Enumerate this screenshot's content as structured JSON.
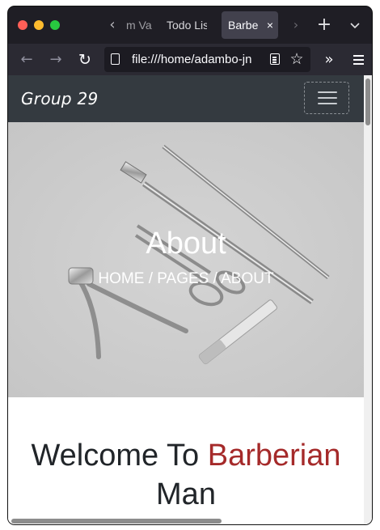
{
  "browser": {
    "tabs": [
      {
        "label": "m Va"
      },
      {
        "label": "Todo Lis"
      },
      {
        "label": "Barbe"
      }
    ],
    "tab_scroll_left": "‹",
    "tab_scroll_right": "›",
    "new_tab": "+",
    "tab_list": "⌄",
    "close_tab": "×",
    "address": "file:///home/adambo-jn",
    "nav": {
      "back": "←",
      "forward": "→",
      "reload": "↻"
    },
    "star": "☆",
    "overflow": "»"
  },
  "site": {
    "brand": "Group 29",
    "hero": {
      "title": "About",
      "breadcrumb": "HOME / PAGES / ABOUT"
    },
    "welcome": {
      "prefix": "Welcome To",
      "accent": "Barberian",
      "suffix": "Man",
      "accent_color": "#a52a2a"
    }
  }
}
